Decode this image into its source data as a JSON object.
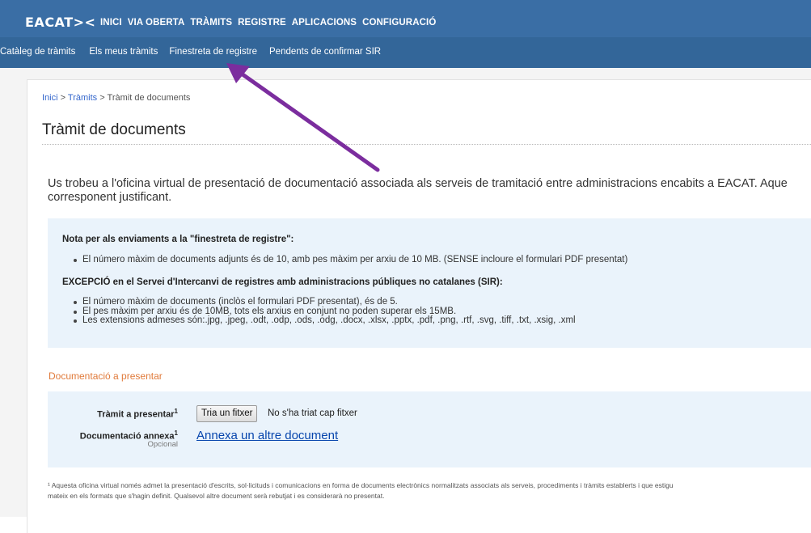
{
  "brand": {
    "logo": "EACAT><"
  },
  "main_menu": [
    "INICI",
    "VIA OBERTA",
    "TRÀMITS",
    "REGISTRE",
    "APLICACIONS",
    "CONFIGURACIÓ"
  ],
  "sub_menu": [
    "Catàleg de tràmits",
    "Els meus tràmits",
    "Finestreta de registre",
    "Pendents de confirmar SIR"
  ],
  "breadcrumb": {
    "home": "Inici",
    "sep1": " > ",
    "section": "Tràmits",
    "sep2": " > ",
    "current": "Tràmit de documents"
  },
  "page_title": "Tràmit de documents",
  "intro": {
    "line1": "Us trobeu a l'oficina virtual de presentació de documentació associada als serveis de tramitació entre administracions encabits a EACAT. Aque",
    "line2": "corresponent justificant."
  },
  "note": {
    "heading": "Nota per als enviaments a la \"finestreta de registre\":",
    "items": [
      "El número màxim de documents adjunts és de 10, amb pes màxim per arxiu de 10 MB. (SENSE incloure el formulari PDF presentat)"
    ],
    "exception_heading": "EXCEPCIÓ en el Servei d'Intercanvi de registres amb administracions públiques no catalanes (SIR):",
    "exception_items": [
      "El número màxim de documents (inclòs el formulari PDF presentat), és de 5.",
      "El pes màxim per arxiu és de 10MB, tots els arxius en conjunt no poden superar els 15MB.",
      "Les extensions admeses són:.jpg, .jpeg, .odt, .odp, .ods, .odg, .docx, .xlsx, .pptx, .pdf, .png, .rtf, .svg, .tiff, .txt, .xsig, .xml"
    ]
  },
  "docs_section": {
    "title": "Documentació a presentar",
    "tramit_label": "Tràmit a presentar",
    "tramit_sup": "1",
    "file_button": "Tria un fitxer",
    "file_status": "No s'ha triat cap fitxer",
    "annex_label": "Documentació annexa",
    "annex_sup": "1",
    "annex_optional": "Opcional",
    "annex_link": "Annexa un altre document"
  },
  "footnote": {
    "line1": "¹  Aquesta oficina virtual només admet la presentació d'escrits, sol·licituds i comunicacions en forma de documents electrònics normalitzats associats als serveis, procediments i tràmits establerts i que estigu",
    "line2": "mateix en els formats que s'hagin definit. Qualsevol altre document serà rebutjat i es considerarà no presentat."
  },
  "colors": {
    "topbar": "#3a6ea5",
    "subbar": "#336699",
    "note_bg": "#eaf3fb",
    "section_title": "#e07a3a",
    "link": "#0645ad",
    "arrow": "#7b2d9e"
  }
}
